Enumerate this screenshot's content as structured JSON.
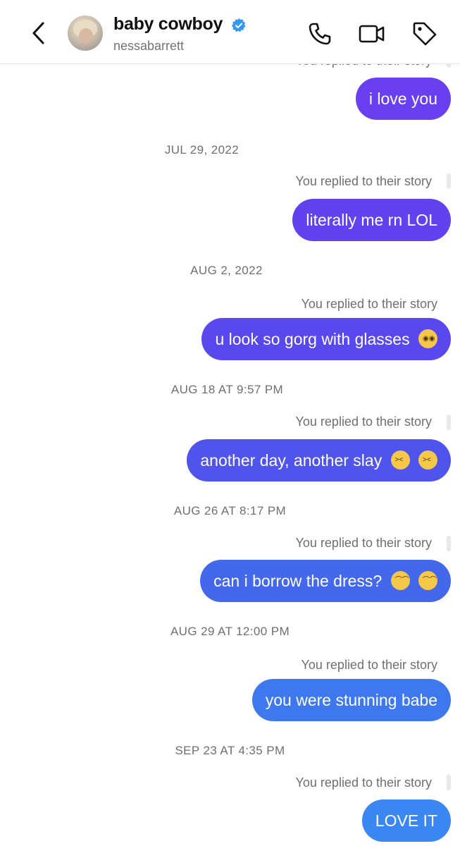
{
  "header": {
    "back_icon": "chevron-left-icon",
    "display_name": "baby cowboy",
    "verified_icon": "verified-badge-icon",
    "username": "nessabarrett",
    "call_icon": "phone-icon",
    "video_icon": "video-camera-icon",
    "tag_icon": "tag-icon"
  },
  "colors": {
    "bubble_gradient": [
      "#6a3ff0",
      "#5b48ef",
      "#4d5ae8",
      "#4368ee",
      "#3d78f0",
      "#3b85f2"
    ],
    "verified": "#3797f0"
  },
  "thread": {
    "top_partial_note": "You replied to their story",
    "messages": [
      {
        "timestamp": "",
        "note": "",
        "text": "i love you",
        "emoji": []
      },
      {
        "timestamp": "JUL 29, 2022",
        "note": "You replied to their story",
        "text": "literally me rn LOL",
        "emoji": []
      },
      {
        "timestamp": "AUG 2, 2022",
        "note": "You replied to their story",
        "text": "u look so gorg with glasses",
        "emoji": [
          "nerd-face"
        ]
      },
      {
        "timestamp": "AUG 18 AT 9:57 PM",
        "note": "You replied to their story",
        "text": "another day, another slay",
        "emoji": [
          "squinting-tongue-face",
          "squinting-tongue-face"
        ]
      },
      {
        "timestamp": "AUG 26 AT 8:17 PM",
        "note": "You replied to their story",
        "text": "can i borrow the dress?",
        "emoji": [
          "loudly-crying-face",
          "loudly-crying-face"
        ]
      },
      {
        "timestamp": "AUG 29 AT 12:00 PM",
        "note": "You replied to their story",
        "text": "you were stunning babe",
        "emoji": []
      },
      {
        "timestamp": "SEP 23 AT 4:35 PM",
        "note": "You replied to their story",
        "text": "LOVE IT",
        "emoji": []
      }
    ]
  }
}
